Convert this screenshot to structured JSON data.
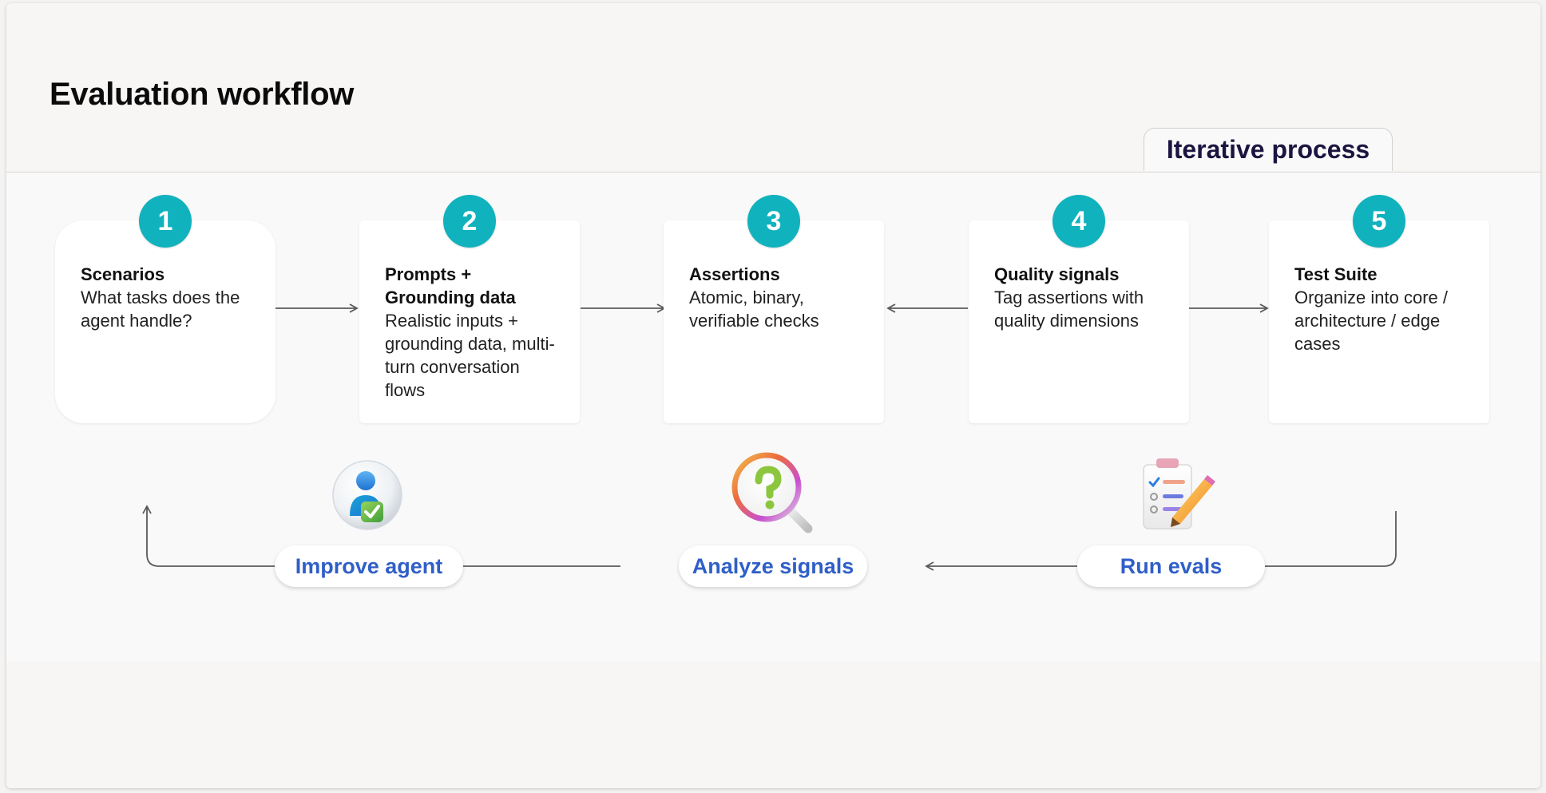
{
  "page_title": "Evaluation workflow",
  "process_tab": "Iterative process",
  "steps": [
    {
      "number": "1",
      "title": "Scenarios",
      "description": "What tasks does the agent handle?"
    },
    {
      "number": "2",
      "title": "Prompts + Grounding data",
      "description": "Realistic inputs + grounding data, multi-turn conversation flows"
    },
    {
      "number": "3",
      "title": "Assertions",
      "description": "Atomic, binary, verifiable checks"
    },
    {
      "number": "4",
      "title": "Quality signals",
      "description": "Tag assertions with quality dimensions"
    },
    {
      "number": "5",
      "title": "Test Suite",
      "description": "Organize into core / architecture / edge cases"
    }
  ],
  "loop_steps": [
    {
      "label": "Improve agent",
      "icon": "person-checkmark-icon"
    },
    {
      "label": "Analyze signals",
      "icon": "magnifier-question-icon"
    },
    {
      "label": "Run evals",
      "icon": "checklist-pencil-icon"
    }
  ],
  "colors": {
    "step_badge": "#10b2bd",
    "loop_label": "#2f5fc7",
    "tab_text": "#1c1440",
    "connector": "#5a5a5a"
  }
}
